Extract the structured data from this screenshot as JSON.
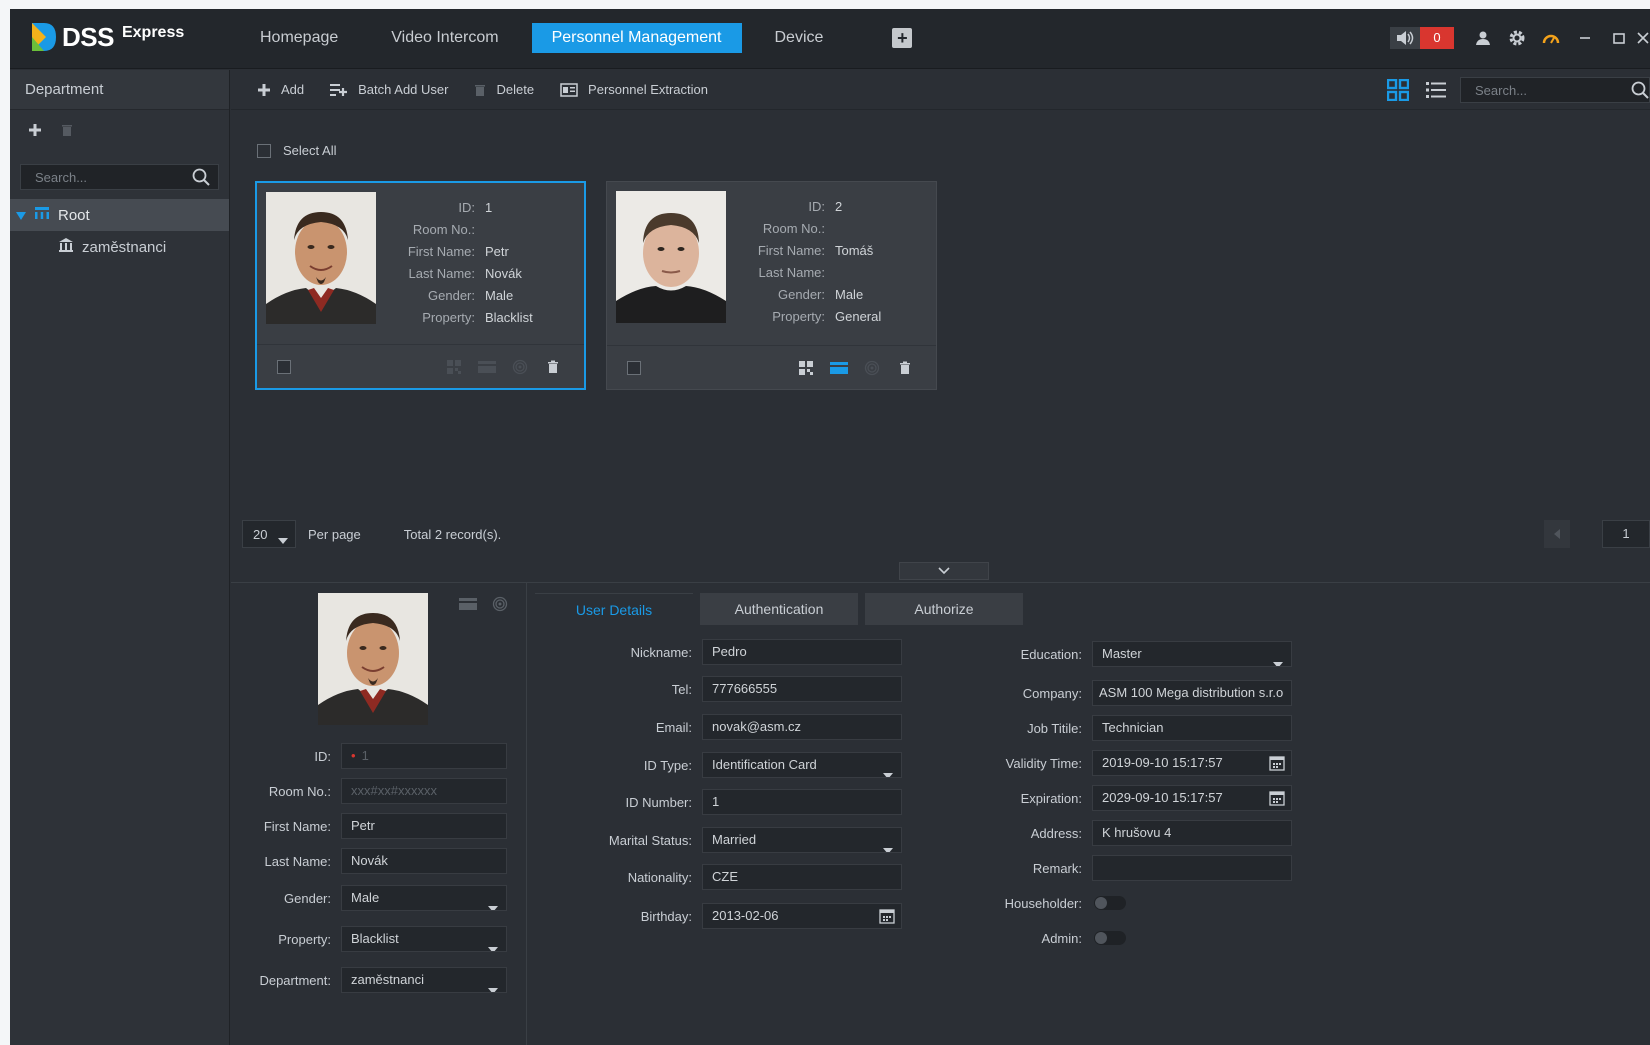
{
  "app": {
    "name": "DSS",
    "subtitle": "Express"
  },
  "nav": {
    "tabs": [
      "Homepage",
      "Video Intercom",
      "Personnel Management",
      "Device"
    ],
    "active": 2
  },
  "alarm_count": "0",
  "colors": {
    "accent": "#1a9ae6",
    "alarm": "#d9362f",
    "bg": "#2b2f35",
    "topbar": "#23272c",
    "card": "#3a3e44"
  },
  "sidebar": {
    "title": "Department",
    "search_placeholder": "Search...",
    "tree": {
      "root": "Root",
      "children": [
        "zaměstnanci"
      ]
    }
  },
  "toolbar": {
    "add": "Add",
    "batch_add": "Batch Add User",
    "delete": "Delete",
    "extraction": "Personnel Extraction",
    "search_placeholder": "Search..."
  },
  "select_all": "Select All",
  "card_labels": {
    "id": "ID:",
    "room": "Room No.:",
    "first": "First Name:",
    "last": "Last Name:",
    "gender": "Gender:",
    "property": "Property:"
  },
  "cards": [
    {
      "id": "1",
      "room": "",
      "first": "Petr",
      "last": "Novák",
      "gender": "Male",
      "property": "Blacklist",
      "selected": true
    },
    {
      "id": "2",
      "room": "",
      "first": "Tomáš",
      "last": "",
      "gender": "Male",
      "property": "General",
      "selected": false
    }
  ],
  "pagination": {
    "per_page_value": "20",
    "per_page_label": "Per page",
    "total": "Total 2 record(s).",
    "page": "1"
  },
  "detail": {
    "left": {
      "id_label": "ID:",
      "id_value": "1",
      "room_label": "Room No.:",
      "room_placeholder": "xxx#xx#xxxxxx",
      "first_label": "First Name:",
      "first_value": "Petr",
      "last_label": "Last Name:",
      "last_value": "Novák",
      "gender_label": "Gender:",
      "gender_value": "Male",
      "property_label": "Property:",
      "property_value": "Blacklist",
      "dept_label": "Department:",
      "dept_value": "zaměstnanci"
    },
    "tabs": [
      "User Details",
      "Authentication",
      "Authorize"
    ],
    "user": {
      "nickname_label": "Nickname:",
      "nickname": "Pedro",
      "tel_label": "Tel:",
      "tel": "777666555",
      "email_label": "Email:",
      "email": "novak@asm.cz",
      "idtype_label": "ID Type:",
      "idtype": "Identification Card",
      "idnum_label": "ID Number:",
      "idnum": "1",
      "marital_label": "Marital Status:",
      "marital": "Married",
      "nationality_label": "Nationality:",
      "nationality": "CZE",
      "birthday_label": "Birthday:",
      "birthday": "2013-02-06",
      "education_label": "Education:",
      "education": "Master",
      "company_label": "Company:",
      "company": "ASM 100 Mega distribution s.r.o",
      "jobtitle_label": "Job Titile:",
      "jobtitle": "Technician",
      "validity_label": "Validity Time:",
      "validity": "2019-09-10 15:17:57",
      "expiration_label": "Expiration:",
      "expiration": "2029-09-10 15:17:57",
      "address_label": "Address:",
      "address": "K hrušovu 4",
      "remark_label": "Remark:",
      "remark": "",
      "householder_label": "Householder:",
      "admin_label": "Admin:"
    }
  }
}
